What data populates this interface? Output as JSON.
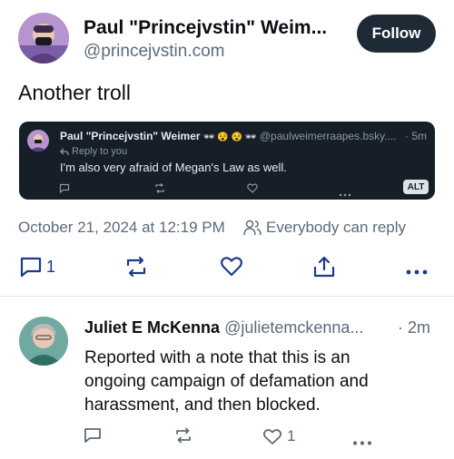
{
  "post": {
    "author_name": "Paul \"Princejvstin\" Weim...",
    "author_handle": "@princejvstin.com",
    "follow_label": "Follow",
    "text": "Another troll",
    "embed": {
      "author_name": "Paul \"Princejvstin\" Weimer",
      "author_emoji": "🕶 😵 😵 🕶",
      "author_handle": "@paulweimerraapes.bsky....",
      "time": "· 5m",
      "reply_to": "Reply to you",
      "text": "I'm also very afraid of Megan's Law as well.",
      "alt_badge": "ALT"
    },
    "timestamp": "October 21, 2024 at 12:19 PM",
    "audience": "Everybody can reply",
    "reply_count": "1"
  },
  "reply": {
    "author_name": "Juliet E McKenna",
    "author_handle": "@julietemckenna...",
    "time": "· 2m",
    "text_lines": [
      "Reported with a note that this is an",
      "ongoing campaign of defamation and",
      "harassment, and then blocked."
    ],
    "like_count": "1"
  },
  "colors": {
    "follow_bg": "#1f2a37",
    "embed_bg": "#161e27",
    "muted": "#5c6b7a",
    "text": "#0b0f14"
  },
  "icons": [
    "avatar",
    "reply-icon",
    "repost-icon",
    "like-icon",
    "share-icon",
    "more-icon",
    "people-icon",
    "reply-arrow-icon"
  ]
}
